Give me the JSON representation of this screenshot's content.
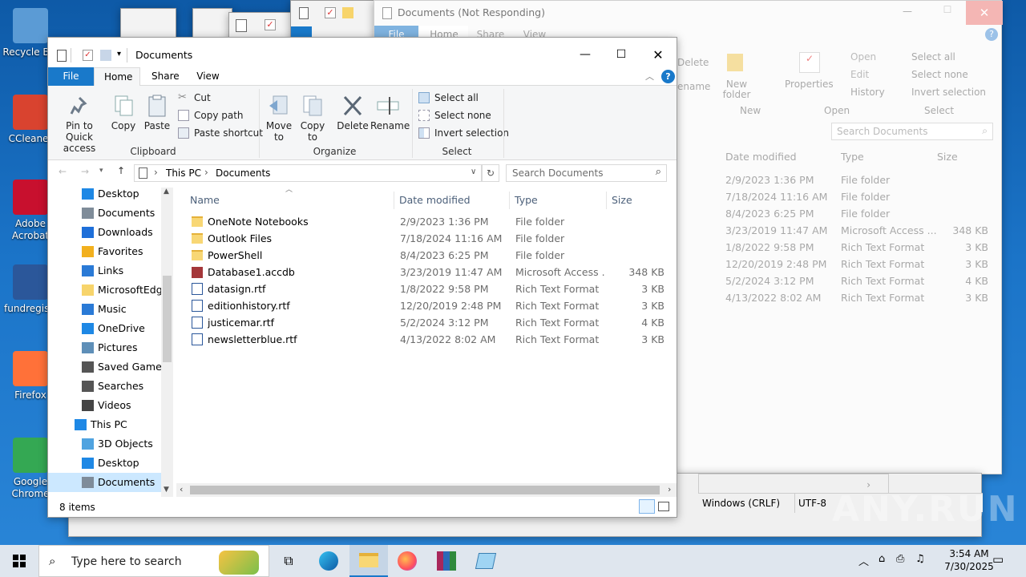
{
  "desktop": {
    "icons": [
      {
        "label": "Recycle Bin",
        "color": "#5b9bd5"
      },
      {
        "label": "CCleaner",
        "color": "#d9432f"
      },
      {
        "label": "Adobe Acrobat",
        "color": "#c8102e"
      },
      {
        "label": "fundregistr",
        "color": "#2b579a"
      },
      {
        "label": "Firefox",
        "color": "#ff7139"
      },
      {
        "label": "Google Chrome",
        "color": "#34a853"
      }
    ]
  },
  "back_window": {
    "title": "Documents (Not Responding)",
    "tabs": [
      "File",
      "Home",
      "Share",
      "View"
    ],
    "ribbon": {
      "delete": "Delete",
      "rename": "ename",
      "new_folder": "New folder",
      "properties": "Properties",
      "open": "Open",
      "edit": "Edit",
      "history": "History",
      "select_all": "Select all",
      "select_none": "Select none",
      "invert": "Invert selection",
      "groups": [
        "New",
        "Open",
        "Select"
      ]
    },
    "search_placeholder": "Search Documents",
    "columns": [
      "Date modified",
      "Type",
      "Size"
    ],
    "rows": [
      [
        "2/9/2023 1:36 PM",
        "File folder",
        ""
      ],
      [
        "7/18/2024 11:16 AM",
        "File folder",
        ""
      ],
      [
        "8/4/2023 6:25 PM",
        "File folder",
        ""
      ],
      [
        "3/23/2019 11:47 AM",
        "Microsoft Access ...",
        "348 KB"
      ],
      [
        "1/8/2022 9:58 PM",
        "Rich Text Format",
        "3 KB"
      ],
      [
        "12/20/2019 2:48 PM",
        "Rich Text Format",
        "3 KB"
      ],
      [
        "5/2/2024 3:12 PM",
        "Rich Text Format",
        "4 KB"
      ],
      [
        "4/13/2022 8:02 AM",
        "Rich Text Format",
        "3 KB"
      ]
    ]
  },
  "notepad_status": {
    "line_ending": "Windows (CRLF)",
    "encoding": "UTF-8"
  },
  "explorer": {
    "title": "Documents",
    "tabs": {
      "file": "File",
      "home": "Home",
      "share": "Share",
      "view": "View"
    },
    "clipboard": {
      "pin": "Pin to Quick access",
      "copy": "Copy",
      "paste": "Paste",
      "cut": "Cut",
      "copy_path": "Copy path",
      "paste_shortcut": "Paste shortcut",
      "group": "Clipboard"
    },
    "organize": {
      "move_to": "Move to",
      "copy_to": "Copy to",
      "delete": "Delete",
      "rename": "Rename",
      "group": "Organize"
    },
    "select": {
      "select_all": "Select all",
      "select_none": "Select none",
      "invert": "Invert selection",
      "group": "Select"
    },
    "breadcrumb": [
      "This PC",
      "Documents"
    ],
    "search_placeholder": "Search Documents",
    "nav": [
      {
        "label": "Desktop",
        "icon": "desktop-icon",
        "color": "#1e88e5"
      },
      {
        "label": "Documents",
        "icon": "documents-icon",
        "color": "#7f8c99"
      },
      {
        "label": "Downloads",
        "icon": "downloads-icon",
        "color": "#1e6fd9"
      },
      {
        "label": "Favorites",
        "icon": "star-icon",
        "color": "#f2b01e"
      },
      {
        "label": "Links",
        "icon": "link-icon",
        "color": "#2a7ad6"
      },
      {
        "label": "MicrosoftEdge",
        "icon": "folder-icon",
        "color": "#f7d46b"
      },
      {
        "label": "Music",
        "icon": "music-icon",
        "color": "#2a7ad6"
      },
      {
        "label": "OneDrive",
        "icon": "cloud-icon",
        "color": "#1e88e5"
      },
      {
        "label": "Pictures",
        "icon": "pictures-icon",
        "color": "#5e8fb8"
      },
      {
        "label": "Saved Games",
        "icon": "games-icon",
        "color": "#555555"
      },
      {
        "label": "Searches",
        "icon": "search-icon",
        "color": "#555555"
      },
      {
        "label": "Videos",
        "icon": "videos-icon",
        "color": "#444444"
      },
      {
        "label": "This PC",
        "icon": "pc-icon",
        "color": "#1e88e5"
      },
      {
        "label": "3D Objects",
        "icon": "3d-icon",
        "color": "#4fa3e0"
      },
      {
        "label": "Desktop",
        "icon": "desktop-icon",
        "color": "#1e88e5"
      },
      {
        "label": "Documents",
        "icon": "documents-icon",
        "color": "#7f8c99"
      }
    ],
    "columns": {
      "name": "Name",
      "date": "Date modified",
      "type": "Type",
      "size": "Size"
    },
    "files": [
      {
        "name": "OneNote Notebooks",
        "date": "2/9/2023 1:36 PM",
        "type": "File folder",
        "size": "",
        "icon": "folder-icon"
      },
      {
        "name": "Outlook Files",
        "date": "7/18/2024 11:16 AM",
        "type": "File folder",
        "size": "",
        "icon": "folder-icon"
      },
      {
        "name": "PowerShell",
        "date": "8/4/2023 6:25 PM",
        "type": "File folder",
        "size": "",
        "icon": "folder-icon"
      },
      {
        "name": "Database1.accdb",
        "date": "3/23/2019 11:47 AM",
        "type": "Microsoft Access ...",
        "size": "348 KB",
        "icon": "access-icon"
      },
      {
        "name": "datasign.rtf",
        "date": "1/8/2022 9:58 PM",
        "type": "Rich Text Format",
        "size": "3 KB",
        "icon": "word-icon"
      },
      {
        "name": "editionhistory.rtf",
        "date": "12/20/2019 2:48 PM",
        "type": "Rich Text Format",
        "size": "3 KB",
        "icon": "word-icon"
      },
      {
        "name": "justicemar.rtf",
        "date": "5/2/2024 3:12 PM",
        "type": "Rich Text Format",
        "size": "4 KB",
        "icon": "word-icon"
      },
      {
        "name": "newsletterblue.rtf",
        "date": "4/13/2022 8:02 AM",
        "type": "Rich Text Format",
        "size": "3 KB",
        "icon": "word-icon"
      }
    ],
    "status": "8 items"
  },
  "taskbar": {
    "search_placeholder": "Type here to search",
    "time": "3:54 AM",
    "date": "7/30/2025"
  },
  "watermark": "ANY.RUN",
  "colors": {
    "accent": "#1979ca",
    "selected": "#cce8ff",
    "folder": "#f8d775"
  }
}
